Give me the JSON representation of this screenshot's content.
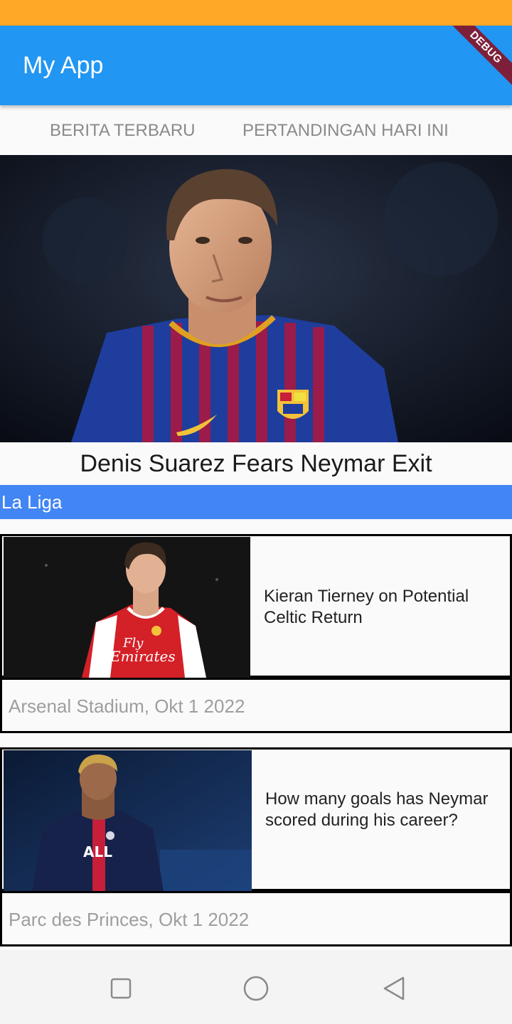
{
  "app_bar": {
    "title": "My App",
    "debug_banner": "DEBUG"
  },
  "tabs": [
    {
      "label": "BERITA TERBARU"
    },
    {
      "label": "PERTANDINGAN HARI INI"
    }
  ],
  "hero": {
    "image": "barcelona-player-photo",
    "title": "Denis Suarez Fears Neymar Exit"
  },
  "league": {
    "label": "La Liga"
  },
  "news": [
    {
      "image": "arsenal-player-photo",
      "headline": "Kieran Tierney on Potential Celtic Return",
      "meta": "Arsenal Stadium, Okt 1 2022"
    },
    {
      "image": "psg-player-photo",
      "headline": "How many goals has Neymar scored during his career?",
      "meta": "Parc des Princes, Okt 1 2022"
    }
  ],
  "nav": {
    "recents_icon": "square-icon",
    "home_icon": "circle-icon",
    "back_icon": "triangle-back-icon"
  },
  "colors": {
    "status_bar": "#ffa726",
    "app_bar": "#2196f3",
    "league_bar": "#4285f4"
  }
}
